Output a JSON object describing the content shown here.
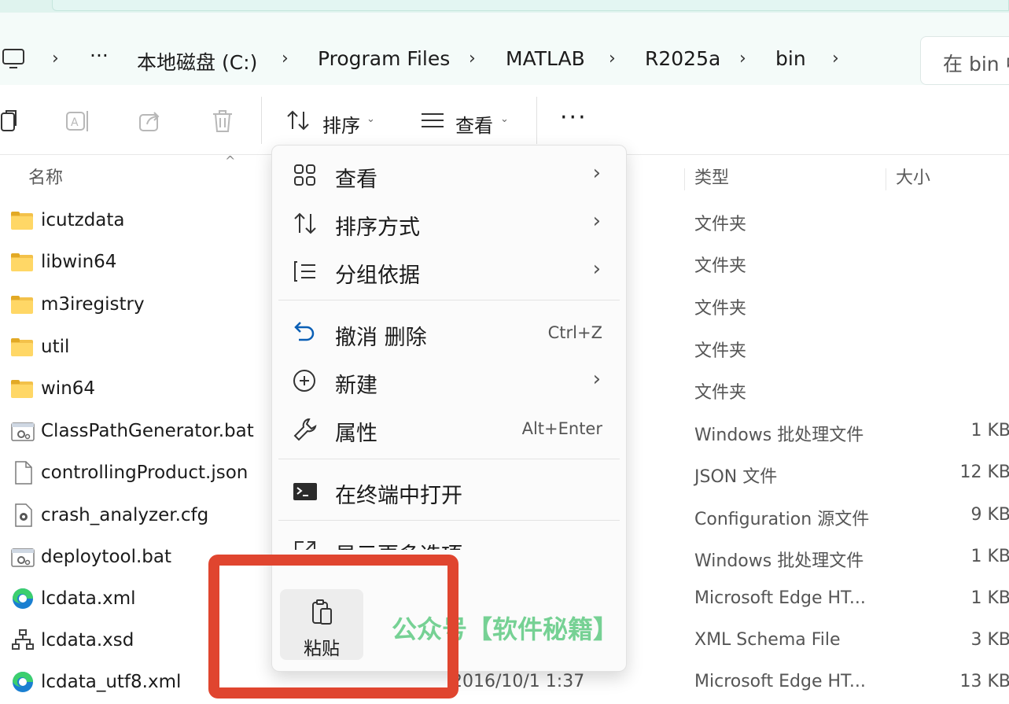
{
  "address_bar": {
    "overflow": "···",
    "crumbs": [
      "本地磁盘 (C:)",
      "Program Files",
      "MATLAB",
      "R2025a",
      "bin"
    ],
    "search_placeholder": "在 bin 中"
  },
  "toolbar": {
    "sort_label": "排序",
    "view_label": "查看",
    "more_label": "···"
  },
  "columns": {
    "name": "名称",
    "type": "类型",
    "size": "大小"
  },
  "files": [
    {
      "name": "icutzdata",
      "icon": "folder-icon",
      "type": "文件夹",
      "size": ""
    },
    {
      "name": "libwin64",
      "icon": "folder-icon",
      "type": "文件夹",
      "size": ""
    },
    {
      "name": "m3iregistry",
      "icon": "folder-icon",
      "type": "文件夹",
      "size": ""
    },
    {
      "name": "util",
      "icon": "folder-icon",
      "type": "文件夹",
      "size": ""
    },
    {
      "name": "win64",
      "icon": "folder-icon",
      "type": "文件夹",
      "size": ""
    },
    {
      "name": "ClassPathGenerator.bat",
      "icon": "batch-file-icon",
      "type": "Windows 批处理文件",
      "size": "1 KB"
    },
    {
      "name": "controllingProduct.json",
      "icon": "json-file-icon",
      "type": "JSON 文件",
      "size": "12 KB"
    },
    {
      "name": "crash_analyzer.cfg",
      "icon": "config-file-icon",
      "type": "Configuration 源文件",
      "size": "9 KB"
    },
    {
      "name": "deploytool.bat",
      "icon": "batch-file-icon",
      "type": "Windows 批处理文件",
      "size": "1 KB"
    },
    {
      "name": "lcdata.xml",
      "icon": "edge-icon",
      "type": "Microsoft Edge HT...",
      "size": "1 KB"
    },
    {
      "name": "lcdata.xsd",
      "icon": "xsd-file-icon",
      "type": "XML Schema File",
      "size": "3 KB"
    },
    {
      "name": "lcdata_utf8.xml",
      "icon": "edge-icon",
      "type": "Microsoft Edge HT...",
      "size": "13 KB",
      "date": "2016/10/1 1:37"
    }
  ],
  "context_menu": {
    "view": "查看",
    "sort_by": "排序方式",
    "group_by": "分组依据",
    "undo": "撤消 删除",
    "undo_shortcut": "Ctrl+Z",
    "new": "新建",
    "properties": "属性",
    "properties_shortcut": "Alt+Enter",
    "open_terminal": "在终端中打开",
    "show_more": "显示更多选项",
    "paste": "粘贴",
    "submenu_arrow": "›"
  },
  "watermark": "公众号【软件秘籍】",
  "colors": {
    "highlight_box": "#e0452f",
    "watermark": "#6fcf8f",
    "folder": "#ffd766",
    "accent": "#0a5fb5"
  }
}
